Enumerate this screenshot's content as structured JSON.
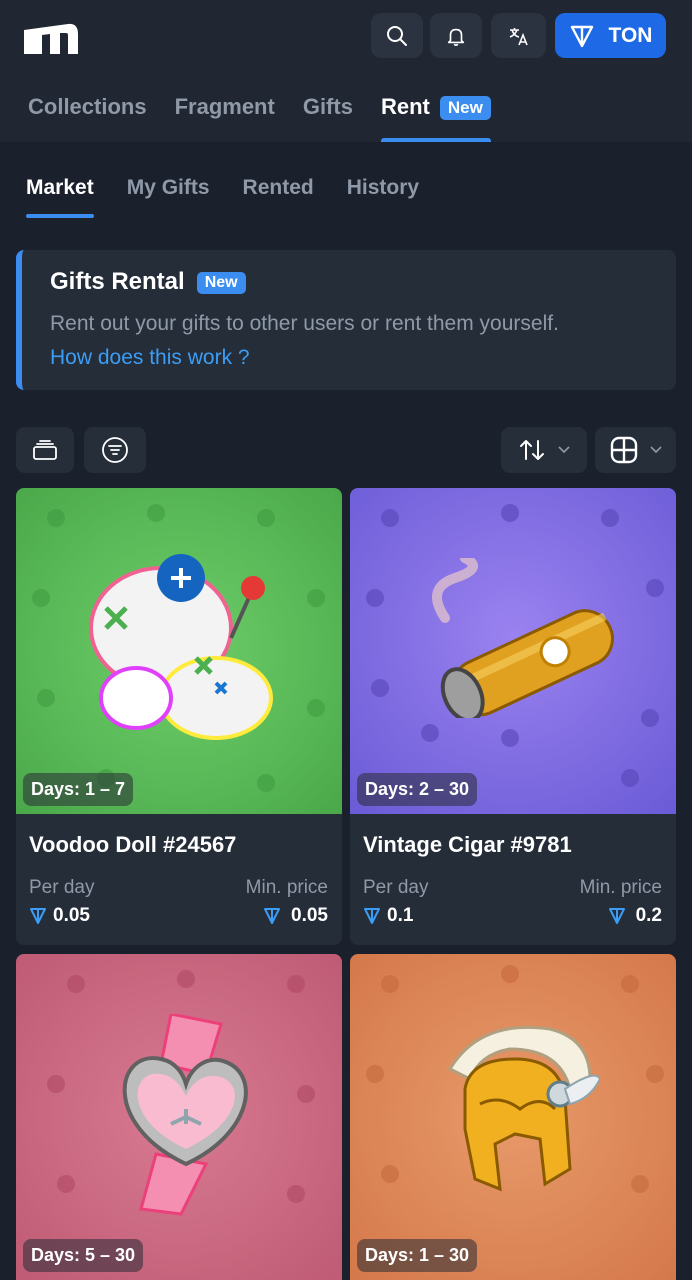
{
  "header": {
    "ton_label": "TON",
    "tabs": [
      {
        "label": "Collections"
      },
      {
        "label": "Fragment"
      },
      {
        "label": "Gifts"
      },
      {
        "label": "Rent",
        "badge": "New"
      }
    ]
  },
  "subtabs": [
    {
      "label": "Market"
    },
    {
      "label": "My Gifts"
    },
    {
      "label": "Rented"
    },
    {
      "label": "History"
    }
  ],
  "banner": {
    "title": "Gifts Rental",
    "badge": "New",
    "description": "Rent out your gifts to other users or rent them yourself.",
    "link": "How does this work ?"
  },
  "cards": [
    {
      "days": "Days: 1 – 7",
      "name": "Voodoo Doll #24567",
      "per_day_label": "Per day",
      "per_day": "0.05",
      "min_label": "Min. price",
      "min_price": "0.05",
      "bg": "#4caf50"
    },
    {
      "days": "Days: 2 – 30",
      "name": "Vintage Cigar #9781",
      "per_day_label": "Per day",
      "per_day": "0.1",
      "min_label": "Min. price",
      "min_price": "0.2",
      "bg": "#7b6be0"
    },
    {
      "days": "Days: 5 – 30",
      "bg": "#c4607a"
    },
    {
      "days": "Days: 1 – 30",
      "bg": "#d98254"
    }
  ],
  "colors": {
    "accent": "#3b8df0",
    "ton_button": "#1e6ae6",
    "background": "#1b212c"
  }
}
